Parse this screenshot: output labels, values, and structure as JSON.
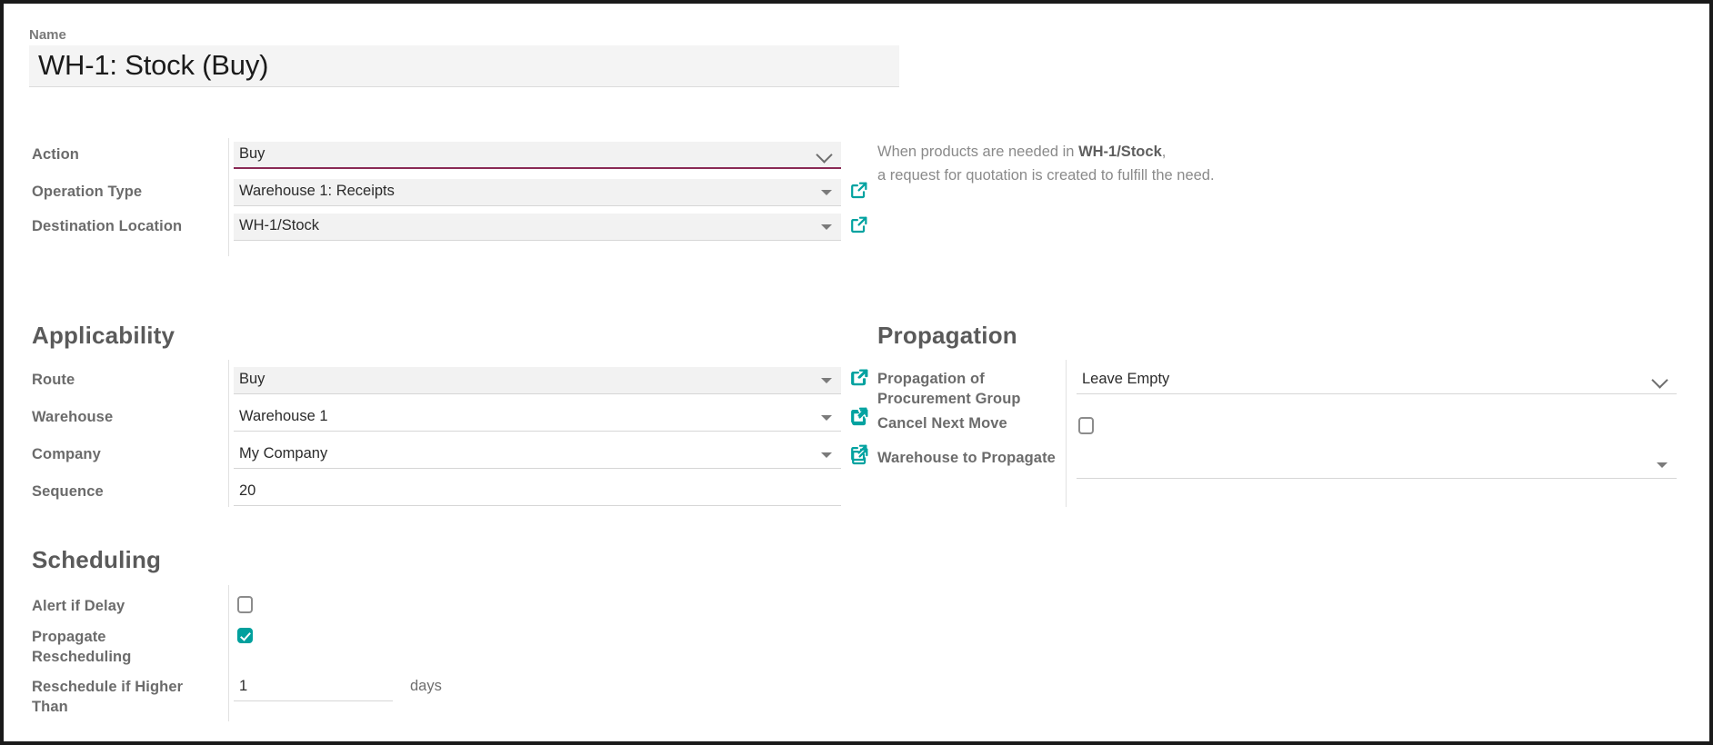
{
  "form": {
    "name_label": "Name",
    "name_value": "WH-1: Stock (Buy)"
  },
  "top_fields": [
    {
      "label": "Action",
      "value": "Buy",
      "caret": "chevron-down-icon",
      "focused": true,
      "has_link": false
    },
    {
      "label": "Operation Type",
      "value": "Warehouse 1: Receipts",
      "caret": "triangle-down-icon",
      "focused": false,
      "has_link": true
    },
    {
      "label": "Destination Location",
      "value": "WH-1/Stock",
      "caret": "triangle-down-icon",
      "focused": false,
      "has_link": true
    }
  ],
  "helper": {
    "line1_pre": "When products are needed in ",
    "line1_bold": "WH-1/Stock",
    "line1_post": ",",
    "line2": "a request for quotation is created to fulfill the need."
  },
  "applicability": {
    "title": "Applicability",
    "fields": [
      {
        "label": "Route",
        "value": "Buy",
        "caret": "triangle-down-icon",
        "has_link": true,
        "highlight": true
      },
      {
        "label": "Warehouse",
        "value": "Warehouse 1",
        "caret": "triangle-down-icon",
        "has_link": true,
        "highlight": false
      },
      {
        "label": "Company",
        "value": "My Company",
        "caret": "triangle-down-icon",
        "has_link": true,
        "highlight": false
      },
      {
        "label": "Sequence",
        "value": "20",
        "caret": "none",
        "has_link": false,
        "highlight": false
      }
    ]
  },
  "propagation": {
    "title": "Propagation",
    "fields": [
      {
        "label": "Propagation of Procurement Group",
        "value": "Leave Empty",
        "caret": "chevron-down-icon",
        "type": "select"
      },
      {
        "label": "Cancel Next Move",
        "value": "",
        "caret": "none",
        "type": "checkbox",
        "checked": false
      },
      {
        "label": "Warehouse to Propagate",
        "value": "",
        "caret": "triangle-down-icon",
        "type": "many2one"
      }
    ]
  },
  "scheduling": {
    "title": "Scheduling",
    "fields": [
      {
        "label": "Alert if Delay",
        "value": "",
        "type": "checkbox",
        "checked": false
      },
      {
        "label": "Propagate Rescheduling",
        "value": "",
        "type": "checkbox",
        "checked": true
      },
      {
        "label": "Reschedule if Higher Than",
        "value": "1",
        "type": "number",
        "suffix": "days"
      }
    ]
  },
  "colors": {
    "accent_teal": "#00a09d",
    "focus_underline": "#8a2a55",
    "label_gray": "#6b6b6b",
    "field_bg": "#f2f2f2"
  }
}
